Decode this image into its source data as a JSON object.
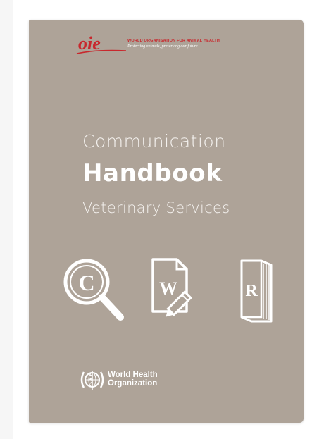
{
  "oie": {
    "logo_text": "OIE",
    "name": "WORLD ORGANISATION FOR ANIMAL HEALTH",
    "slogan": "Protecting animals, preserving our future"
  },
  "cover": {
    "title_line_1": "Communication",
    "title_line_2": "Handbook",
    "title_line_3": "Veterinary Services",
    "icons": [
      {
        "name": "copyright-magnifier-icon",
        "letter": "C"
      },
      {
        "name": "document-pencil-icon",
        "letter": "W"
      },
      {
        "name": "book-icon",
        "letter": "R"
      }
    ]
  },
  "who": {
    "line_1": "World Health",
    "line_2": "Organization"
  },
  "colors": {
    "cover_background": "#aea398",
    "oie_red": "#c8282d",
    "text_white": "#ffffff"
  }
}
